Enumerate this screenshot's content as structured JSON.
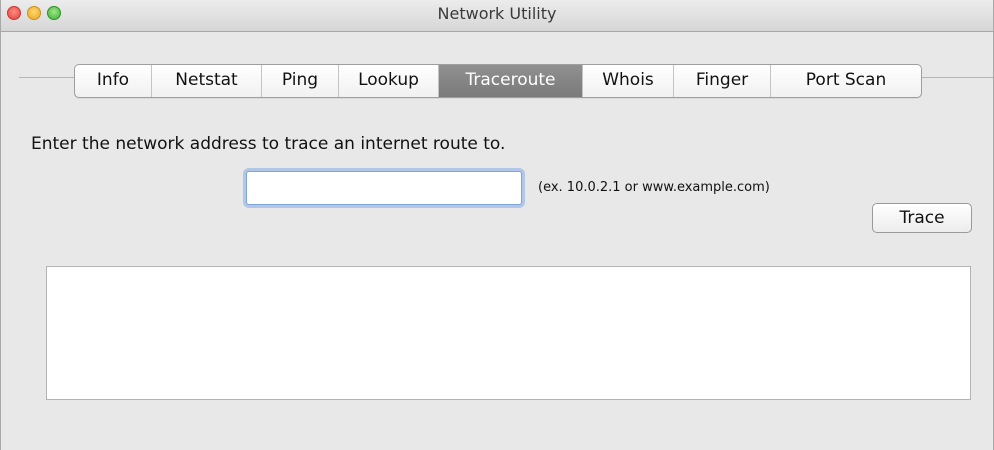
{
  "window": {
    "title": "Network Utility"
  },
  "tabs": [
    {
      "label": "Info",
      "selected": false
    },
    {
      "label": "Netstat",
      "selected": false
    },
    {
      "label": "Ping",
      "selected": false
    },
    {
      "label": "Lookup",
      "selected": false
    },
    {
      "label": "Traceroute",
      "selected": true
    },
    {
      "label": "Whois",
      "selected": false
    },
    {
      "label": "Finger",
      "selected": false
    },
    {
      "label": "Port Scan",
      "selected": false
    }
  ],
  "traceroute": {
    "prompt": "Enter the network address to trace an internet route to.",
    "address_value": "",
    "address_placeholder": "",
    "hint": "(ex. 10.0.2.1 or www.example.com)",
    "trace_label": "Trace",
    "output": ""
  },
  "colors": {
    "window_bg": "#e8e8e8",
    "selected_tab": "#838383",
    "focus_ring": "#7fa6d8",
    "close_button": "#e0443e",
    "minimize_button": "#e7a826",
    "zoom_button": "#3eae33"
  },
  "icons": {
    "close": "close-traffic-light-icon",
    "minimize": "minimize-traffic-light-icon",
    "zoom": "zoom-traffic-light-icon"
  }
}
